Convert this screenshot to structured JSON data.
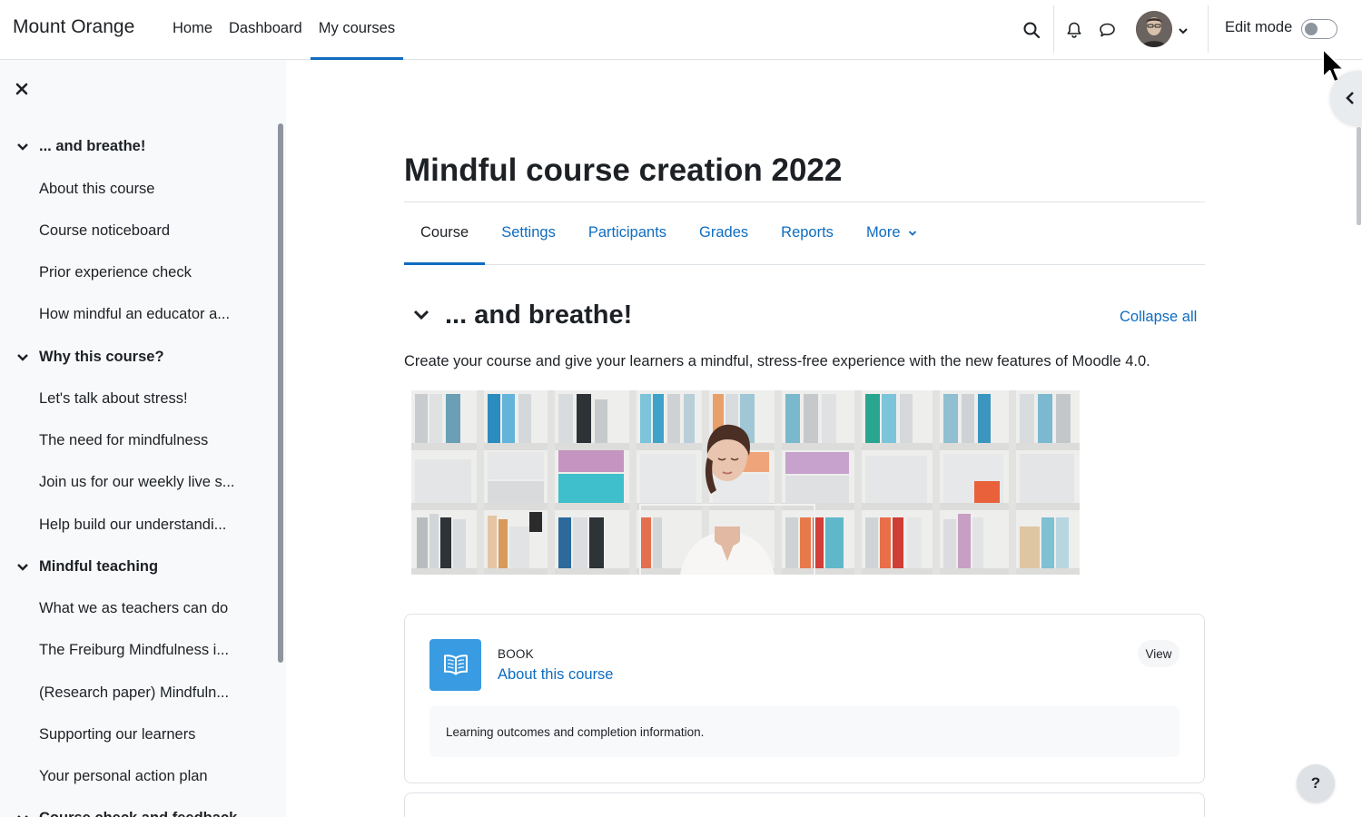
{
  "navbar": {
    "brand": "Mount Orange",
    "links": [
      {
        "label": "Home"
      },
      {
        "label": "Dashboard"
      },
      {
        "label": "My courses"
      }
    ],
    "edit_mode_label": "Edit mode",
    "edit_mode_on": false,
    "icons": [
      "search-icon",
      "bell-icon",
      "chat-icon",
      "avatar",
      "chevron-down-icon"
    ]
  },
  "drawer": {
    "sections": [
      {
        "title": "... and breathe!",
        "items": [
          "About this course",
          "Course noticeboard",
          "Prior experience check",
          "How mindful an educator a..."
        ]
      },
      {
        "title": "Why this course?",
        "items": [
          "Let's talk about stress!",
          "The need for mindfulness",
          "Join us for our weekly live s...",
          "Help build our understandi..."
        ]
      },
      {
        "title": "Mindful teaching",
        "items": [
          "What we as teachers can do",
          "The Freiburg Mindfulness i...",
          "(Research paper) Mindfuln...",
          "Supporting our learners",
          "Your personal action plan"
        ]
      },
      {
        "title": "Course check and feedback",
        "items": []
      }
    ]
  },
  "course": {
    "title": "Mindful course creation 2022",
    "tabs": [
      {
        "label": "Course"
      },
      {
        "label": "Settings"
      },
      {
        "label": "Participants"
      },
      {
        "label": "Grades"
      },
      {
        "label": "Reports"
      },
      {
        "label": "More"
      }
    ],
    "section_title": "... and breathe!",
    "collapse_all": "Collapse all",
    "summary": "Create your course and give your learners a mindful, stress-free experience with the new features of Moodle 4.0."
  },
  "activity": {
    "type": "BOOK",
    "name": "About this course",
    "view_label": "View",
    "description": "Learning outcomes and completion information."
  },
  "help": {
    "label": "?"
  },
  "colors": {
    "accent": "#0f6cbf",
    "book_icon": "#399be2",
    "drawer_bg": "#f8f9fa"
  }
}
